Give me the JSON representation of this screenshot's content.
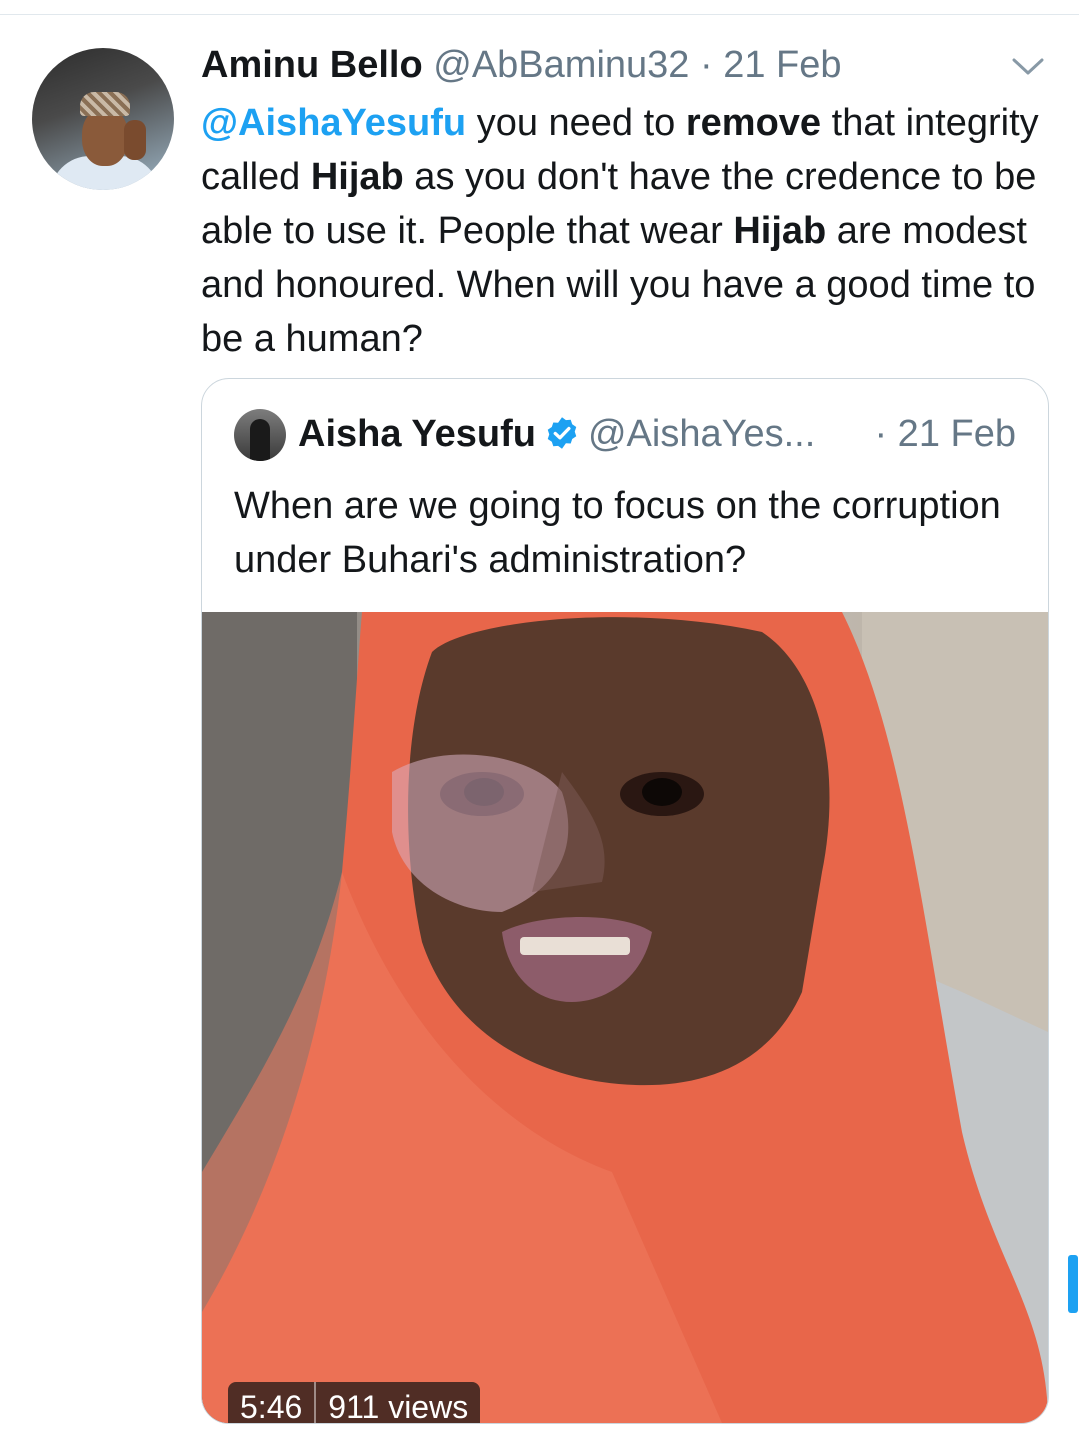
{
  "tweet": {
    "author_name": "Aminu Bello",
    "handle": "@AbBaminu32",
    "date_separator": "·",
    "date": "21 Feb",
    "text_parts": {
      "mention": "@AishaYesufu",
      "t1": " you need to ",
      "b1": "remove",
      "t2": " that integrity called ",
      "b2": "Hijab",
      "t3": " as you don't have the credence to be able to use it. People that wear ",
      "b3": "Hijab",
      "t4": " are modest and honoured. When will you have a good time to be a human?"
    },
    "avatar_icon": "user-avatar",
    "menu_icon": "chevron-down-icon"
  },
  "quoted_tweet": {
    "author_name": "Aisha Yesufu",
    "verified_icon": "verified-badge-icon",
    "handle": "@AishaYes...",
    "date": "· 21 Feb",
    "text": "When are we going to focus on the corruption under Buhari's administration?",
    "video": {
      "duration": "5:46",
      "views": "911 views"
    }
  },
  "colors": {
    "accent": "#1da1f2",
    "secondary_text": "#657786",
    "hijab": "#e8664a"
  }
}
